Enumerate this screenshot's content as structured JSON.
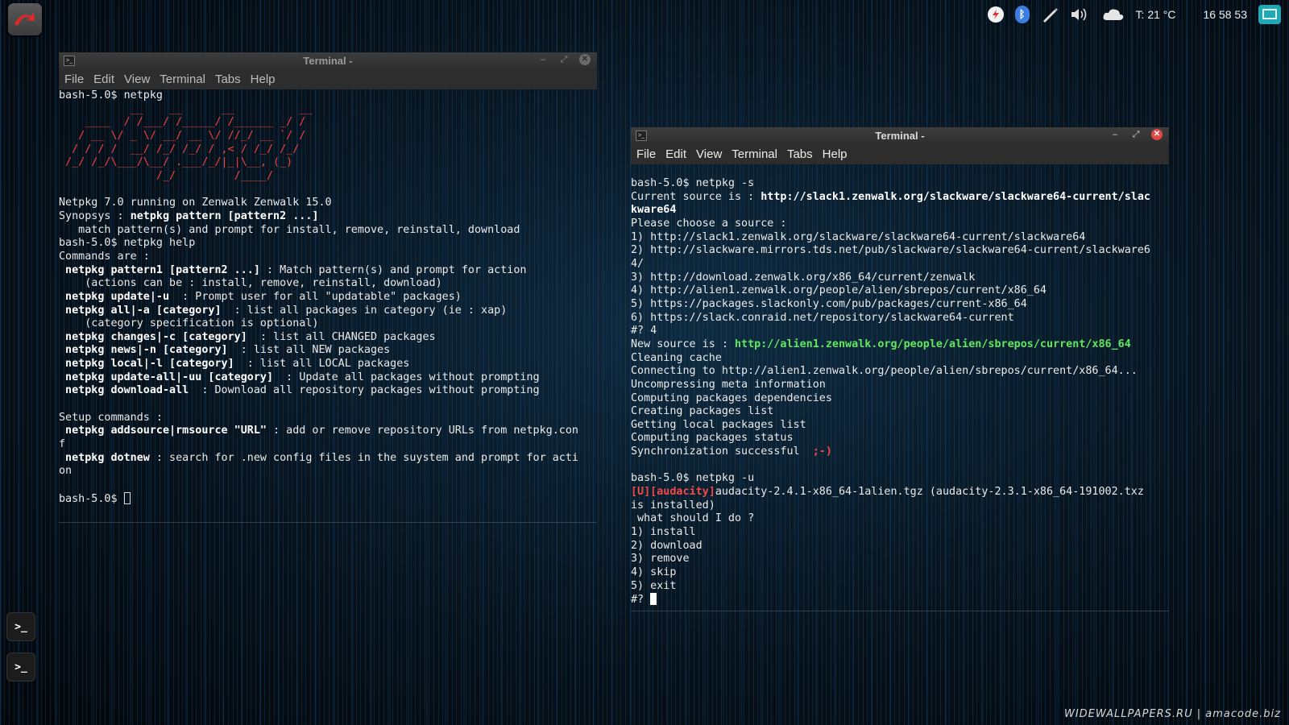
{
  "panel": {
    "temperature": "T: 21 °C",
    "clock": "16 58 53"
  },
  "dock": [
    "terminal-icon",
    "terminal-icon"
  ],
  "term1": {
    "title": "Terminal -",
    "menu": [
      "File",
      "Edit",
      "View",
      "Terminal",
      "Tabs",
      "Help"
    ],
    "l1": "bash-5.0$ netpkg",
    "art": [
      "           __    __      __          __",
      "    ____  / /___/ /_____/ /______ _/ /",
      "   / __ \\/ _ \\/ __/ __ \\/ //_/ __ `/ /",
      "  / / / /  __/ /_/ /_/ / ,< / /_/ /_/",
      " /_/ /_/\\___/\\__/ .___/_/|_|\\__, (_)",
      "               /_/         /____/"
    ],
    "l2": "Netpkg 7.0 running on Zenwalk Zenwalk 15.0",
    "l3a": "Synopsys : ",
    "l3b": "netpkg pattern [pattern2 ...]",
    "l4": "   match pattern(s) and prompt for install, remove, reinstall, download",
    "l5": "bash-5.0$ netpkg help",
    "l6": "Commands are :",
    "c1a": " netpkg pattern1 [pattern2 ...]",
    "c1b": " : Match pattern(s) and prompt for action",
    "c1c": "    (actions can be : install, remove, reinstall, download)",
    "c2a": " netpkg update|-u",
    "c2b": "  : Prompt user for all \"updatable\" packages)",
    "c3a": " netpkg all|-a [category]",
    "c3b": "  : list all packages in category (ie : xap)",
    "c3c": "    (category specification is optional)",
    "c4a": " netpkg changes|-c [category]",
    "c4b": "  : list all CHANGED packages",
    "c5a": " netpkg news|-n [category]",
    "c5b": "  : list all NEW packages",
    "c6a": " netpkg local|-l [category]",
    "c6b": "  : list all LOCAL packages",
    "c7a": " netpkg update-all|-uu [category]",
    "c7b": "  : Update all packages without prompting",
    "c8a": " netpkg download-all",
    "c8b": "  : Download all repository packages without prompting",
    "s0": "Setup commands :",
    "s1a": " netpkg addsource|rmsource \"URL\"",
    "s1b": " : add or remove repository URLs from netpkg.con",
    "s1c": "f",
    "s2a": " netpkg dotnew",
    "s2b": " : search for .new config files in the suystem and prompt for acti",
    "s2c": "on",
    "prompt": "bash-5.0$ "
  },
  "term2": {
    "title": "Terminal -",
    "menu": [
      "File",
      "Edit",
      "View",
      "Terminal",
      "Tabs",
      "Help"
    ],
    "l1": "bash-5.0$ netpkg -s",
    "l2a": "Current source is : ",
    "l2b": "http://slack1.zenwalk.org/slackware/slackware64-current/slac",
    "l2c": "kware64",
    "l3": "Please choose a source :",
    "o1": "1) http://slack1.zenwalk.org/slackware/slackware64-current/slackware64",
    "o2": "2) http://slackware.mirrors.tds.net/pub/slackware/slackware64-current/slackware6",
    "o2b": "4/",
    "o3": "3) http://download.zenwalk.org/x86_64/current/zenwalk",
    "o4": "4) http://alien1.zenwalk.org/people/alien/sbrepos/current/x86_64",
    "o5": "5) https://packages.slackonly.com/pub/packages/current-x86_64",
    "o6": "6) https://slack.conraid.net/repository/slackware64-current",
    "sel": "#? 4",
    "ns_a": "New source is : ",
    "ns_b": "http://alien1.zenwalk.org/people/alien/sbrepos/current/x86_64",
    "p1": "Cleaning cache",
    "p2": "Connecting to http://alien1.zenwalk.org/people/alien/sbrepos/current/x86_64...",
    "p3": "Uncompressing meta information",
    "p4": "Computing packages dependencies",
    "p5": "Creating packages list",
    "p6": "Getting local packages list",
    "p7": "Computing packages status",
    "p8a": "Synchronization successful  ",
    "p8b": ";-)",
    "u1": "bash-5.0$ netpkg -u",
    "u2a": "[U][audacity]",
    "u2b": "audacity-2.4.1-x86_64-1alien.tgz (audacity-2.3.1-x86_64-191002.txz",
    "u3": "is installed)",
    "q": " what should I do ?",
    "a1": "1) install",
    "a2": "2) download",
    "a3": "3) remove",
    "a4": "4) skip",
    "a5": "5) exit",
    "prompt": "#? "
  },
  "watermark": "WIDEWALLPAPERS.RU | amacode.biz"
}
